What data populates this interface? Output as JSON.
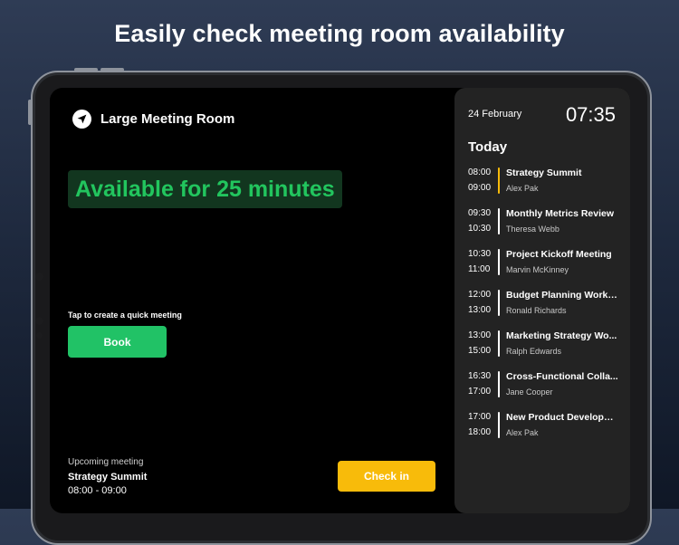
{
  "headline": "Easily check meeting room availability",
  "room": {
    "name": "Large Meeting Room",
    "availability": "Available for 25 minutes",
    "quick_label": "Tap to create a quick meeting",
    "book_label": "Book",
    "upcoming_label": "Upcoming meeting",
    "upcoming_title": "Strategy Summit",
    "upcoming_time": "08:00 - 09:00",
    "checkin_label": "Check in"
  },
  "panel": {
    "date": "24 February",
    "clock": "07:35",
    "today": "Today",
    "events": [
      {
        "start": "08:00",
        "end": "09:00",
        "title": "Strategy Summit",
        "person": "Alex Pak",
        "active": true
      },
      {
        "start": "09:30",
        "end": "10:30",
        "title": "Monthly Metrics Review",
        "person": "Theresa Webb",
        "active": false
      },
      {
        "start": "10:30",
        "end": "11:00",
        "title": "Project Kickoff Meeting",
        "person": "Marvin McKinney",
        "active": false
      },
      {
        "start": "12:00",
        "end": "13:00",
        "title": "Budget Planning Works...",
        "person": "Ronald Richards",
        "active": false
      },
      {
        "start": "13:00",
        "end": "15:00",
        "title": "Marketing Strategy Wo...",
        "person": "Ralph Edwards",
        "active": false
      },
      {
        "start": "16:30",
        "end": "17:00",
        "title": "Cross-Functional Colla...",
        "person": "Jane Cooper",
        "active": false
      },
      {
        "start": "17:00",
        "end": "18:00",
        "title": "New Product Developm...",
        "person": "Alex Pak",
        "active": false
      }
    ]
  },
  "colors": {
    "available_green": "#22c55e",
    "book_green": "#21c266",
    "checkin_yellow": "#f8bb0a",
    "active_bar": "#f8bb0a"
  },
  "icons": {
    "room": "location-arrow-icon"
  }
}
